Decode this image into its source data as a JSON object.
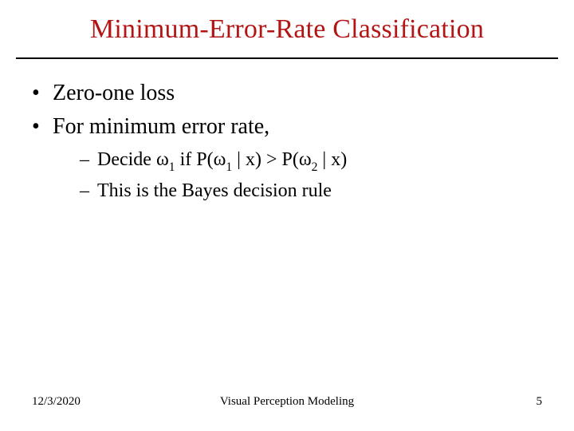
{
  "title": {
    "text": "Minimum-Error-Rate Classification",
    "color": "#B31515"
  },
  "bullets": {
    "items": [
      {
        "text": "Zero-one loss"
      },
      {
        "text": "For minimum error rate,"
      }
    ],
    "subitems": [
      {
        "prefix": "Decide ",
        "omega1": "ω",
        "sub1": "1",
        "mid1": " if P(",
        "omega2": "ω",
        "sub2": "1",
        "mid2": " | x) > P(",
        "omega3": "ω",
        "sub3": "2",
        "suffix": " | x)"
      },
      {
        "text": "This is the Bayes decision rule"
      }
    ]
  },
  "footer": {
    "date": "12/3/2020",
    "center": "Visual Perception Modeling",
    "page": "5"
  }
}
